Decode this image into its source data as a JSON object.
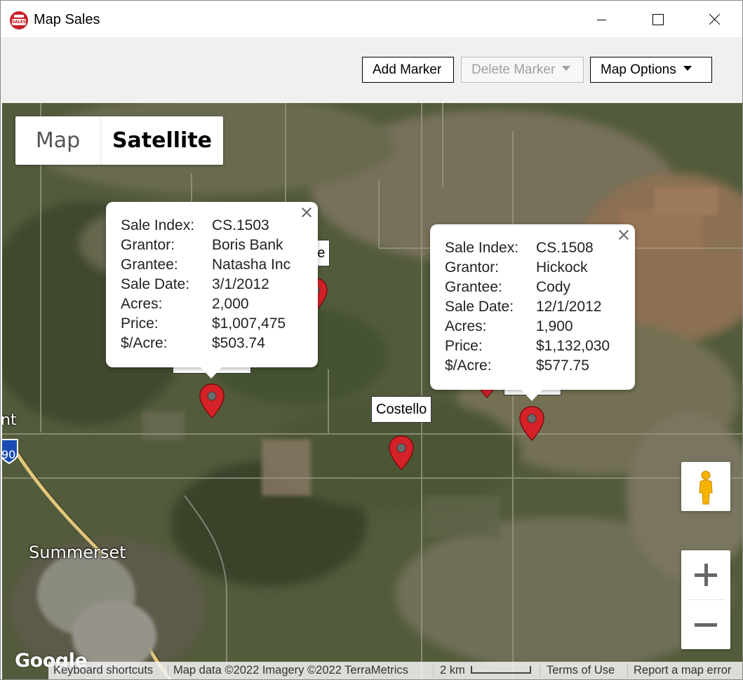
{
  "window": {
    "title": "Map Sales",
    "icon": "sales-sign-icon",
    "icon_text": "SALES",
    "controls": [
      "minimize-icon",
      "maximize-icon",
      "close-icon"
    ]
  },
  "toolbar": {
    "add_marker_label": "Add Marker",
    "delete_marker_label": "Delete Marker",
    "map_options_label": "Map Options"
  },
  "map": {
    "map_type": {
      "map_label": "Map",
      "satellite_label": "Satellite",
      "selected": "Satellite"
    },
    "labels": {
      "partial_hoe": "hoe",
      "costello": "Costello"
    },
    "place_names": {
      "summerset": "Summerset",
      "partial_nt": "nt",
      "highway": "90"
    },
    "popups": [
      {
        "keys": [
          "Sale Index:",
          "Grantor:",
          "Grantee:",
          "Sale Date:",
          "Acres:",
          "Price:",
          "$/Acre:"
        ],
        "values": [
          "CS.1503",
          "Boris Bank",
          "Natasha Inc",
          "3/1/2012",
          "2,000",
          "$1,007,475",
          "$503.74"
        ]
      },
      {
        "keys": [
          "Sale Index:",
          "Grantor:",
          "Grantee:",
          "Sale Date:",
          "Acres:",
          "Price:",
          "$/Acre:"
        ],
        "values": [
          "CS.1508",
          "Hickock",
          "Cody",
          "12/1/2012",
          "1,900",
          "$1,132,030",
          "$577.75"
        ]
      }
    ],
    "controls": {
      "pegman": "pegman-icon",
      "zoom_in": "plus-icon",
      "zoom_out": "minus-icon"
    },
    "google_logo": "Google",
    "footer": {
      "keyboard_shortcuts": "Keyboard shortcuts",
      "map_data": "Map data ©2022 Imagery ©2022 TerraMetrics",
      "scale": "2 km",
      "terms": "Terms of Use",
      "report": "Report a map error"
    },
    "colors": {
      "marker": "#d42228",
      "marker_dot": "#6b6b6b"
    }
  }
}
